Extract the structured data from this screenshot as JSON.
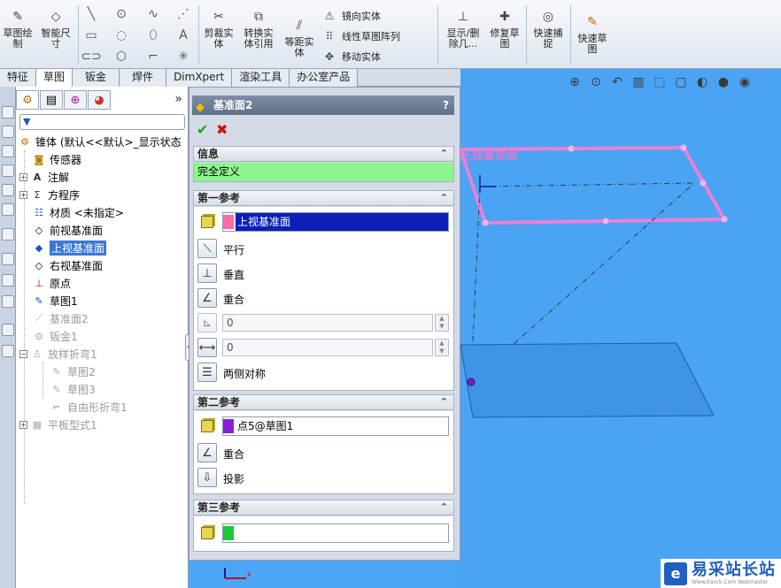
{
  "toolbar": {
    "sketch_label": "草图绘\n制",
    "smart_dim_label": "智能尺\n寸",
    "trim_label": "剪裁实\n体",
    "convert_label": "转换实\n体引用",
    "offset_label": "等距实\n体",
    "mirror_label": "镜向实体",
    "linear_pattern_label": "线性草图阵列",
    "move_label": "移动实体",
    "display_delete_label": "显示/删\n除几...",
    "repair_label": "修复草\n图",
    "quick_snap_label": "快速捕\n捉",
    "rapid_sketch_label": "快速草\n图"
  },
  "tabs": [
    {
      "label": "特征",
      "active": false
    },
    {
      "label": "草图",
      "active": true
    },
    {
      "label": "钣金",
      "active": false
    },
    {
      "label": "焊件",
      "active": false
    },
    {
      "label": "DimXpert",
      "active": false
    },
    {
      "label": "渲染工具",
      "active": false
    },
    {
      "label": "办公室产品",
      "active": false
    }
  ],
  "tree": {
    "root": "锥体 (默认<<默认>_显示状态",
    "items": {
      "sensors": "传感器",
      "annotations": "注解",
      "equations": "方程序",
      "material": "材质 <未指定>",
      "front_plane": "前视基准面",
      "top_plane": "上视基准面",
      "right_plane": "右视基准面",
      "origin": "原点",
      "sketch1": "草图1",
      "plane2": "基准面2",
      "sheet_metal1": "钣金1",
      "lofted_bend1": "放样折弯1",
      "sketch2": "草图2",
      "sketch3": "草图3",
      "freeform_bend1": "自由形折弯1",
      "flat_pattern1": "平板型式1"
    }
  },
  "pm": {
    "title": "基准面2",
    "help": "?",
    "info_header": "信息",
    "info_status": "完全定义",
    "first_ref_header": "第一参考",
    "first_ref_value": "上视基准面",
    "parallel": "平行",
    "perpendicular": "垂直",
    "coincident": "重合",
    "angle_value": "0",
    "distance_value": "0",
    "mid_plane": "两侧对称",
    "second_ref_header": "第二参考",
    "second_ref_value": "点5@草图1",
    "coincident2": "重合",
    "projection": "投影",
    "third_ref_header": "第三参考",
    "third_ref_value": ""
  },
  "viewport": {
    "plane_label": "上视基准面"
  },
  "watermark": {
    "main": "易采站长站",
    "sub": "Www.Easck.Com Webmaster"
  },
  "colors": {
    "viewport_bg": "#4aa3f3",
    "plane_outline": "#ec7fd6",
    "info_ok": "#8df58d",
    "first_ref_marker": "#ff6aa8",
    "second_ref_marker": "#8a1fd8",
    "third_ref_marker": "#19c83c",
    "selection_bg": "#0b1fb8"
  }
}
